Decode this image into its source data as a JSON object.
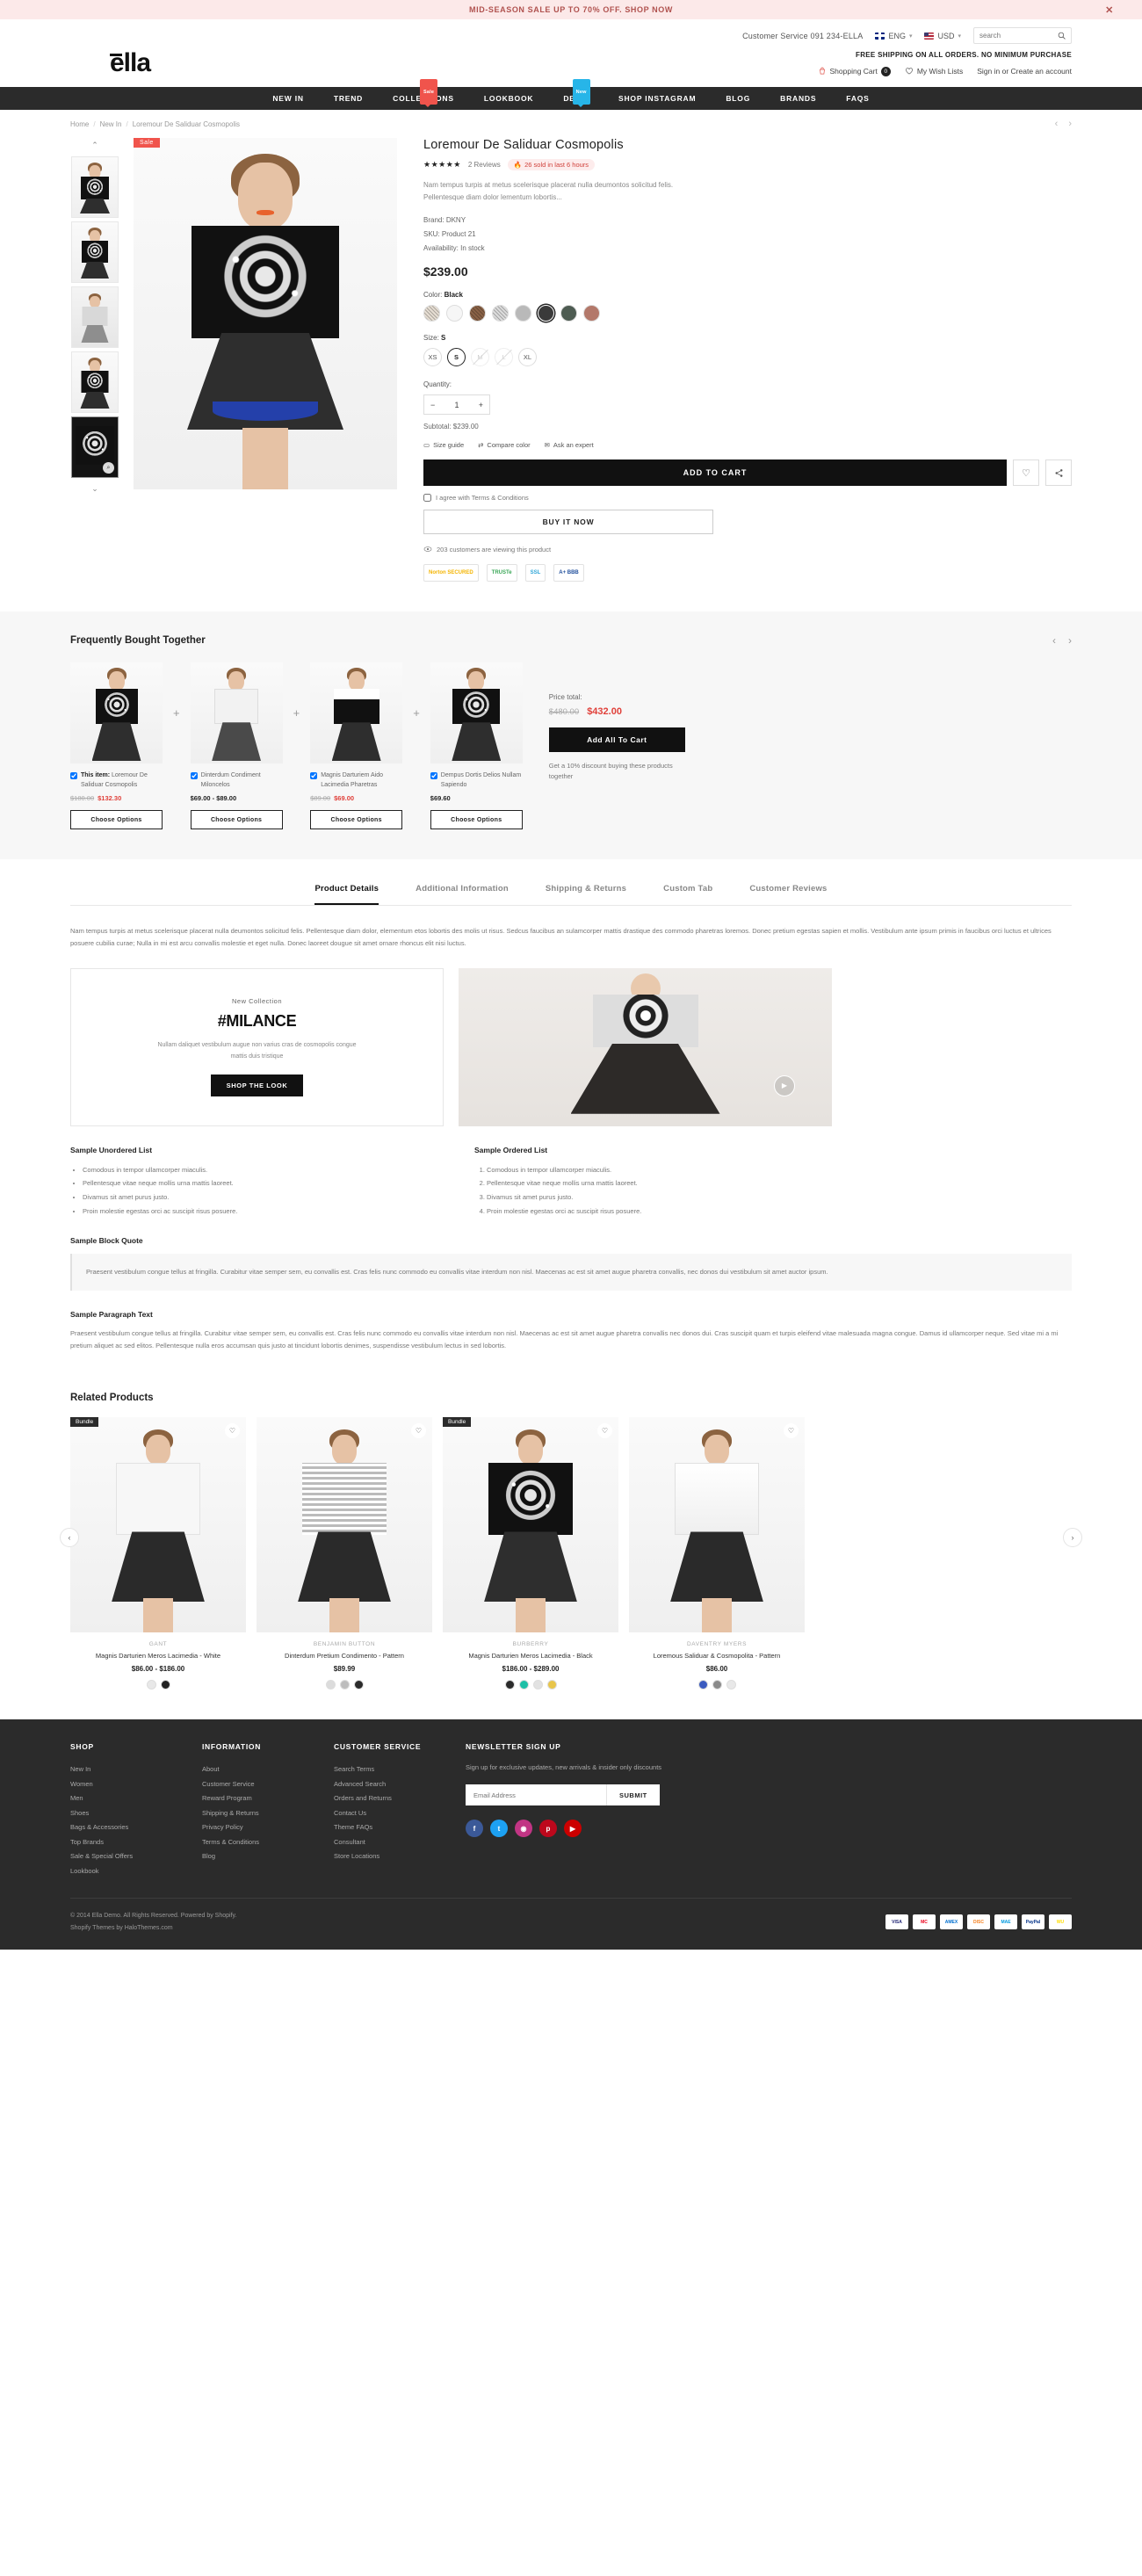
{
  "announcement": {
    "text": "MID-SEASON SALE UP TO 70% OFF. SHOP NOW",
    "close": "✕"
  },
  "utility": {
    "customer_service": "Customer Service 091 234-ELLA",
    "language": "ENG",
    "currency": "USD",
    "search_placeholder": "search"
  },
  "header": {
    "logo": "ella",
    "free_shipping": "FREE SHIPPING ON ALL ORDERS. NO MINIMUM PURCHASE",
    "cart_label": "Shopping Cart",
    "cart_count": "0",
    "wishlist_label": "My Wish Lists",
    "account_label": "Sign in or Create an account"
  },
  "nav": [
    {
      "label": "NEW IN",
      "badge": null
    },
    {
      "label": "TREND",
      "badge": null
    },
    {
      "label": "COLLECTIONS",
      "badge": "Sale",
      "badge_type": "sale"
    },
    {
      "label": "LOOKBOOK",
      "badge": null
    },
    {
      "label": "DEMO",
      "badge": "New",
      "badge_type": "new"
    },
    {
      "label": "SHOP INSTAGRAM",
      "badge": null
    },
    {
      "label": "BLOG",
      "badge": null
    },
    {
      "label": "BRANDS",
      "badge": null
    },
    {
      "label": "FAQS",
      "badge": null
    }
  ],
  "breadcrumb": {
    "home": "Home",
    "newin": "New In",
    "current": "Loremour De Saliduar Cosmopolis",
    "sep": "/"
  },
  "product": {
    "sale_flag": "Sale",
    "title": "Loremour De Saliduar Cosmopolis",
    "stars": "★★★★★",
    "reviews": "2 Reviews",
    "sold_pill": "26 sold in last 6 hours",
    "description": "Nam tempus turpis at metus scelerisque placerat nulla deumontos solicitud felis. Pellentesque diam dolor lementum lobortis...",
    "brand_label": "Brand:",
    "brand_value": "DKNY",
    "sku_label": "SKU:",
    "sku_value": "Product 21",
    "availability_label": "Availability:",
    "availability_value": "In stock",
    "price": "$239.00",
    "color_label": "Color:",
    "color_value": "Black",
    "colors": [
      {
        "name": "beige-paisley",
        "hex": "#e6ded3",
        "selected": false
      },
      {
        "name": "white",
        "hex": "#f6f6f6",
        "selected": false
      },
      {
        "name": "brown-print",
        "hex": "#8a6246",
        "selected": false
      },
      {
        "name": "light-stripe",
        "hex": "#dcdcdc",
        "selected": false
      },
      {
        "name": "grey",
        "hex": "#b9b9b9",
        "selected": false
      },
      {
        "name": "black",
        "hex": "#3a3a3a",
        "selected": true
      },
      {
        "name": "dark-green",
        "hex": "#4e5c52",
        "selected": false
      },
      {
        "name": "clay",
        "hex": "#b3786a",
        "selected": false
      }
    ],
    "size_label": "Size:",
    "size_value": "S",
    "sizes": [
      {
        "label": "XS",
        "state": "normal"
      },
      {
        "label": "S",
        "state": "selected"
      },
      {
        "label": "M",
        "state": "disabled"
      },
      {
        "label": "L",
        "state": "disabled"
      },
      {
        "label": "XL",
        "state": "normal"
      }
    ],
    "qty_label": "Quantity:",
    "qty_minus": "−",
    "qty_value": "1",
    "qty_plus": "+",
    "subtotal": "Subtotal: $239.00",
    "tools": [
      {
        "icon": "ruler-icon",
        "label": "Size guide"
      },
      {
        "icon": "compare-icon",
        "label": "Compare color"
      },
      {
        "icon": "mail-icon",
        "label": "Ask an expert"
      }
    ],
    "add_to_cart": "ADD TO CART",
    "wishlist_icon": "♡",
    "share_icon": "⟨",
    "agree_text": "I agree with Terms & Conditions",
    "buy_now": "BUY IT NOW",
    "viewing": "203 customers are viewing this product",
    "trust_badges": [
      "Norton SECURED",
      "TRUSTe",
      "SSL",
      "A+ BBB"
    ]
  },
  "fbt": {
    "title": "Frequently Bought Together",
    "items": [
      {
        "check_prefix": "This item:",
        "name": "Loremour De Saliduar Cosmopolis",
        "old_price": "$180.00",
        "new_price": "$132.30",
        "price_solid": null,
        "button": "Choose Options",
        "checked": true
      },
      {
        "check_prefix": null,
        "name": "Dinterdum Condiment Miloncelos",
        "old_price": null,
        "new_price": null,
        "price_solid": "$69.00 - $89.00",
        "button": "Choose Options",
        "checked": true
      },
      {
        "check_prefix": null,
        "name": "Magnis Darturiem Aido Lacimedia Pharetras",
        "old_price": "$89.00",
        "new_price": "$69.00",
        "price_solid": null,
        "button": "Choose Options",
        "checked": true
      },
      {
        "check_prefix": null,
        "name": "Dempus Dortis Delios Nullam Sapiendo",
        "old_price": null,
        "new_price": null,
        "price_solid": "$69.60",
        "button": "Choose Options",
        "checked": true
      }
    ],
    "total_label": "Price total:",
    "total_old": "$480.00",
    "total_new": "$432.00",
    "add_all": "Add All To Cart",
    "note": "Get a 10% discount buying these products together"
  },
  "tabs": {
    "items": [
      {
        "label": "Product Details",
        "active": true
      },
      {
        "label": "Additional Information",
        "active": false
      },
      {
        "label": "Shipping & Returns",
        "active": false
      },
      {
        "label": "Custom Tab",
        "active": false
      },
      {
        "label": "Customer Reviews",
        "active": false
      }
    ],
    "intro": "Nam tempus turpis at metus scelerisque placerat nulla deumontos solicitud felis. Pellentesque diam dolor, elementum etos lobortis des molis ut risus. Sedcus faucibus an sulamcorper mattis drastique des commodo pharetras loremos. Donec pretium egestas sapien et mollis. Vestibulum ante ipsum primis in faucibus orci luctus et ultrices posuere cubilia curae; Nulla in mi est arcu convallis molestie et eget nulla. Donec laoreet dougue sit amet ornare rhoncus elit nisi luctus.",
    "promo": {
      "kicker": "New Collection",
      "headline": "#MILANCE",
      "sub": "Nullam daliquet vestibulum augue non varius cras de cosmopolis congue mattis duis tristique",
      "button": "SHOP THE LOOK",
      "play": "▶"
    },
    "unordered_title": "Sample Unordered List",
    "unordered": [
      "Comodous in tempor ullamcorper miaculis.",
      "Pellentesque vitae neque mollis urna mattis laoreet.",
      "Divamus sit amet purus justo.",
      "Proin molestie egestas orci ac suscipit risus posuere."
    ],
    "ordered_title": "Sample Ordered List",
    "ordered": [
      "Comodous in tempor ullamcorper miaculis.",
      "Pellentesque vitae neque mollis urna mattis laoreet.",
      "Divamus sit amet purus justo.",
      "Proin molestie egestas orci ac suscipit risus posuere."
    ],
    "quote_title": "Sample Block Quote",
    "quote": "Praesent vestibulum congue tellus at fringilla. Curabitur vitae semper sem, eu convallis est. Cras felis nunc commodo eu convallis vitae interdum non nisl. Maecenas ac est sit amet augue pharetra convallis, nec donos dui vestibulum sit amet auctor ipsum.",
    "para_title": "Sample Paragraph Text",
    "para": "Praesent vestibulum congue tellus at fringilla. Curabitur vitae semper sem, eu convallis est. Cras felis nunc commodo eu convallis vitae interdum non nisl. Maecenas ac est sit amet augue pharetra convallis nec donos dui. Cras suscipit quam et turpis eleifend vitae malesuada magna congue. Damus id ullamcorper neque. Sed vitae mi a mi pretium aliquet ac sed elitos. Pellentesque nulla eros accumsan quis justo at tincidunt lobortis denimes, suspendisse vestibulum lectus in sed lobortis."
  },
  "related": {
    "title": "Related Products",
    "prev": "‹",
    "next": "›",
    "items": [
      {
        "bundle": "Bundle",
        "brand": "GANT",
        "name": "Magnis Darturien Meros Lacimedia - White",
        "price": "$86.00 - $186.00",
        "wish": "♡",
        "swatches": [
          "#e8e8e8",
          "#222222"
        ]
      },
      {
        "bundle": null,
        "brand": "BENJAMIN BUTTON",
        "name": "Dinterdum Pretium Condimento - Pattern",
        "price": "$89.99",
        "wish": "♡",
        "swatches": [
          "#dcdcdc",
          "#bdbdbd",
          "#2b2b2b"
        ]
      },
      {
        "bundle": "Bundle",
        "brand": "BURBERRY",
        "name": "Magnis Darturien Meros Lacimedia - Black",
        "price": "$186.00 - $289.00",
        "wish": "♡",
        "swatches": [
          "#2b2b2b",
          "#1dbfa6",
          "#e2e2e2",
          "#e8c54a"
        ]
      },
      {
        "bundle": null,
        "brand": "DAVENTRY MYERS",
        "name": "Loremous Saliduar & Cosmopolita - Pattern",
        "price": "$86.00",
        "wish": "♡",
        "swatches": [
          "#3b5bbf",
          "#8a8a8a",
          "#e8e8e8"
        ]
      }
    ]
  },
  "footer": {
    "columns": [
      {
        "title": "SHOP",
        "links": [
          "New In",
          "Women",
          "Men",
          "Shoes",
          "Bags & Accessories",
          "Top Brands",
          "Sale & Special Offers",
          "Lookbook"
        ]
      },
      {
        "title": "INFORMATION",
        "links": [
          "About",
          "Customer Service",
          "Reward Program",
          "Shipping & Returns",
          "Privacy Policy",
          "Terms & Conditions",
          "Blog"
        ]
      },
      {
        "title": "CUSTOMER SERVICE",
        "links": [
          "Search Terms",
          "Advanced Search",
          "Orders and Returns",
          "Contact Us",
          "Theme FAQs",
          "Consultant",
          "Store Locations"
        ]
      }
    ],
    "newsletter": {
      "title": "NEWSLETTER SIGN UP",
      "text": "Sign up for exclusive updates, new arrivals & insider only discounts",
      "placeholder": "Email Address",
      "button": "SUBMIT"
    },
    "socials": [
      {
        "name": "facebook-icon",
        "glyph": "f",
        "hex": "#3b5998"
      },
      {
        "name": "twitter-icon",
        "glyph": "t",
        "hex": "#1da1f2"
      },
      {
        "name": "instagram-icon",
        "glyph": "◉",
        "hex": "#c13584"
      },
      {
        "name": "pinterest-icon",
        "glyph": "p",
        "hex": "#bd081c"
      },
      {
        "name": "youtube-icon",
        "glyph": "▶",
        "hex": "#cc0000"
      }
    ],
    "copyright": "© 2014 Ella Demo. All Rights Reserved. Powered by Shopify.",
    "credit": "Shopify Themes by HaloThemes.com",
    "payments": [
      {
        "label": "VISA",
        "hex": "#1a1f71"
      },
      {
        "label": "MC",
        "hex": "#eb001b"
      },
      {
        "label": "AMEX",
        "hex": "#006fcf"
      },
      {
        "label": "DISC",
        "hex": "#f58220"
      },
      {
        "label": "MAE",
        "hex": "#0099df"
      },
      {
        "label": "PayPal",
        "hex": "#003087"
      },
      {
        "label": "WU",
        "hex": "#ffdd00"
      }
    ]
  }
}
